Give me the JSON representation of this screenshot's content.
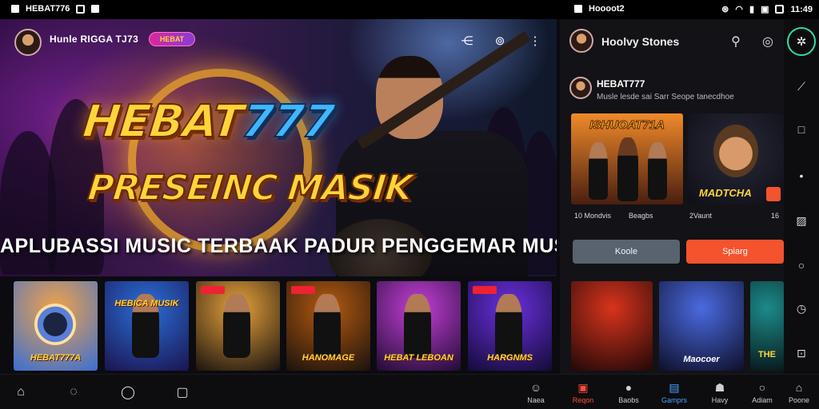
{
  "status_bar": {
    "app_label": "HEBAT776",
    "mid_label": "Hoooot2",
    "time": "11:49"
  },
  "hero": {
    "channel_name": "Hunle RIGGA TJ73",
    "badge_label": "HEBAT",
    "brand_part1": "HEBAT",
    "brand_part2": "777",
    "subtitle": "PRESEINC MASIK",
    "tagline": "APLUBASSI MUSIC TERBAAK PADUR PENGGEMAR MUSIK"
  },
  "thumbnails": [
    {
      "caption": "HEBAT777A",
      "bg1": "#f0a24a",
      "bg2": "#3a6fd1"
    },
    {
      "caption": "HEBICA MUSIK",
      "bg1": "#2a6fd8",
      "bg2": "#1b1450"
    },
    {
      "caption": "",
      "bg1": "#e7a23a",
      "bg2": "#1a1310"
    },
    {
      "caption": "HANOMAGE",
      "bg1": "#b45a10",
      "bg2": "#1b120d"
    },
    {
      "caption": "HEBAT LEBOAN",
      "bg1": "#c43fd7",
      "bg2": "#200c34"
    },
    {
      "caption": "HARGNMS",
      "bg1": "#6a30e0",
      "bg2": "#140b38"
    }
  ],
  "right_panel": {
    "title": "Hoolvy Stones",
    "profile_name": "HEBAT777",
    "profile_sub": "Musle lesde sai Sarr Seope tanecdhoe",
    "cards": [
      {
        "caption": "ISHUOAT71A",
        "label_left": "10 Mondvis",
        "label_right": "Beagbs"
      },
      {
        "caption": "MADTCHA",
        "label_left": "2Vaunt",
        "label_right": "16"
      }
    ],
    "btn_left": "Koole",
    "btn_right": "Spiarg",
    "small_cards": [
      {
        "caption": "",
        "bg1": "#d8341c",
        "bg2": "#200808"
      },
      {
        "caption": "Maocoer",
        "bg1": "#4a6ae0",
        "bg2": "#0e0f2a"
      },
      {
        "caption": "THE",
        "bg1": "#1c8a8a",
        "bg2": "#081a1c"
      }
    ]
  },
  "bottom_nav": {
    "items": [
      {
        "label": "Naea",
        "glyph": "☺"
      },
      {
        "label": "Reqon",
        "glyph": "▣"
      },
      {
        "label": "Baobs",
        "glyph": "●"
      },
      {
        "label": "Gamprs",
        "glyph": "▤"
      },
      {
        "label": "Havy",
        "glyph": "☗"
      },
      {
        "label": "Adiam",
        "glyph": "○"
      },
      {
        "label": "Poone",
        "glyph": "⌂"
      }
    ]
  },
  "colors": {
    "accent_red": "#f4532e",
    "accent_green": "#2ee0a0",
    "brand_gold": "#ffd53a",
    "brand_blue": "#3fb7ff"
  }
}
